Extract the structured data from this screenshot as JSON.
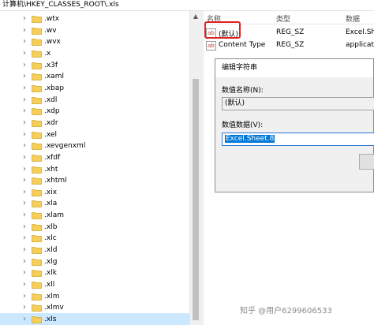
{
  "address_bar": {
    "path": "计算机\\HKEY_CLASSES_ROOT\\.xls"
  },
  "tree": {
    "items": [
      {
        "label": ".wtx"
      },
      {
        "label": ".wv"
      },
      {
        "label": ".wvx"
      },
      {
        "label": ".x"
      },
      {
        "label": ".x3f"
      },
      {
        "label": ".xaml"
      },
      {
        "label": ".xbap"
      },
      {
        "label": ".xdl"
      },
      {
        "label": ".xdp"
      },
      {
        "label": ".xdr"
      },
      {
        "label": ".xel"
      },
      {
        "label": ".xevgenxml"
      },
      {
        "label": ".xfdf"
      },
      {
        "label": ".xht"
      },
      {
        "label": ".xhtml"
      },
      {
        "label": ".xix"
      },
      {
        "label": ".xla"
      },
      {
        "label": ".xlam"
      },
      {
        "label": ".xlb"
      },
      {
        "label": ".xlc"
      },
      {
        "label": ".xld"
      },
      {
        "label": ".xlg"
      },
      {
        "label": ".xlk"
      },
      {
        "label": ".xll"
      },
      {
        "label": ".xlm"
      },
      {
        "label": ".xlmv"
      },
      {
        "label": ".xls"
      }
    ],
    "selected_label": ".xls"
  },
  "values_pane": {
    "columns": {
      "name": "名称",
      "type": "类型",
      "data": "数据"
    },
    "rows": [
      {
        "icon": "ab",
        "name": "(默认)",
        "type": "REG_SZ",
        "data": "Excel.She"
      },
      {
        "icon": "ab",
        "name": "Content Type",
        "type": "REG_SZ",
        "data": "applicat"
      }
    ]
  },
  "edit_dialog": {
    "title": "编辑字符串",
    "value_name_label": "数值名称(N):",
    "value_name": "(默认)",
    "value_data_label": "数值数据(V):",
    "value_data": "Excel.Sheet.8"
  },
  "watermark": "知乎 @用户6299606533",
  "colors": {
    "highlight_box": "#e02020",
    "selection": "#0078d7",
    "folder": "#f5cf5a"
  }
}
